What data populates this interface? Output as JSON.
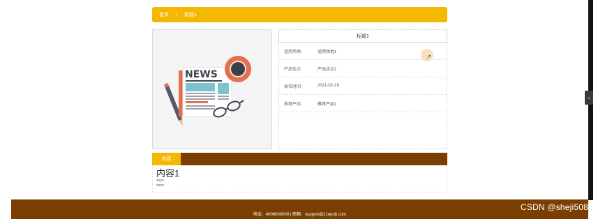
{
  "breadcrumb": {
    "home": "首页",
    "separator": "/",
    "current": "标题1"
  },
  "product": {
    "image_label": "NEWS",
    "title": "标题1",
    "rows": [
      {
        "key": "适用场地:",
        "value": "适用场地1"
      },
      {
        "key": "产品优点:",
        "value": "产品优点1"
      },
      {
        "key": "发布时间:",
        "value": "2021-02-19"
      },
      {
        "key": "推荐产品:",
        "value": "推荐产品1"
      }
    ]
  },
  "content": {
    "tab_label": "内容",
    "title": "内容1",
    "lines": [
      "xxxx",
      "xxxx"
    ]
  },
  "footer": {
    "text": "电话：4008000000 | 邮箱：support@21epub.com"
  },
  "watermark": "CSDN @sheji508",
  "colors": {
    "accent": "#f5b800",
    "brown": "#7a3e00"
  }
}
